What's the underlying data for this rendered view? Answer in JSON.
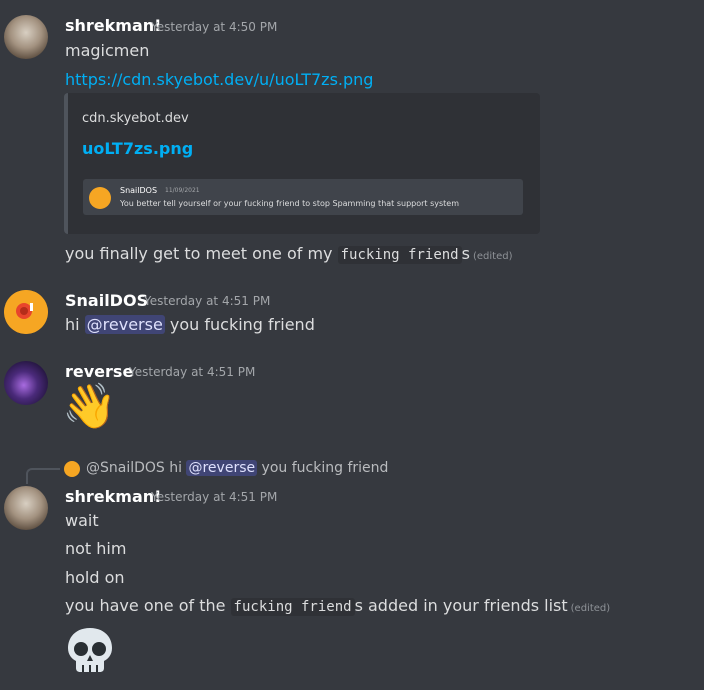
{
  "messages": [
    {
      "author": "shrekman!",
      "timestamp": "Yesterday at 4:50 PM",
      "lines": {
        "l1": "magicmen",
        "link": "https://cdn.skyebot.dev/u/uoLT7zs.png",
        "l3_before": "you finally get to meet one of my ",
        "l3_code": "fucking friend",
        "l3_after": "s",
        "l3_edited": "(edited)"
      },
      "embed": {
        "provider": "cdn.skyebot.dev",
        "title": "uoLT7zs.png",
        "image": {
          "author": "SnailDOS",
          "date": "11/09/2021",
          "text": "You better tell yourself or your fucking friend to stop Spamming that support system"
        }
      }
    },
    {
      "author": "SnailDOS",
      "timestamp": "Yesterday at 4:51 PM",
      "line_before": "hi ",
      "mention": "@reverse",
      "line_after": " you fucking friend"
    },
    {
      "author": "reverse",
      "timestamp": "Yesterday at 4:51 PM",
      "emoji": "👋"
    },
    {
      "reply": {
        "author": "@SnailDOS",
        "before": " hi ",
        "mention": "@reverse",
        "after": " you fucking friend"
      },
      "author": "shrekman!",
      "timestamp": "Yesterday at 4:51 PM",
      "lines": {
        "l1": "wait",
        "l2": "not him",
        "l3": "hold on",
        "l4_before": "you have one of the ",
        "l4_code": "fucking friend",
        "l4_after": "s added in your friends list",
        "l4_edited": "(edited)"
      },
      "emoji": "skull"
    }
  ],
  "colors": {
    "background": "#36393f",
    "link": "#00aff4",
    "mention_bg": "#5865f2",
    "username": "#ffffff"
  }
}
